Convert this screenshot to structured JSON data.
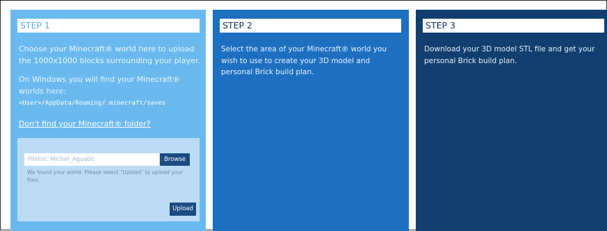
{
  "steps": [
    {
      "title": "STEP 1",
      "paragraph1": "Choose your Minecraft® world here to upload the 1000x1000 blocks surrounding your player.",
      "paragraph2": "On Windows you will find your Minecraft® worlds here:",
      "path": "<User>/AppData/Roaming/.minecraft/saves",
      "link": "Don't find your Minecraft® folder?",
      "upload_box": {
        "file_placeholder": "Filelist: Michel_Aquatic",
        "browse_label": "Browse",
        "found_message": "We found your world. Please select \"Upload\" to upload your files.",
        "upload_label": "Upload"
      }
    },
    {
      "title": "STEP 2",
      "paragraph1": "Select the area of your Minecraft® world you wish to use to create your 3D model and personal Brick build plan."
    },
    {
      "title": "STEP 3",
      "paragraph1": "Download your 3D model STL file and get your personal Brick build plan."
    }
  ],
  "colors": {
    "step1_bg": "#6ab9ee",
    "step2_bg": "#1e6fc0",
    "step3_bg": "#123f70",
    "upload_box_bg": "#bcdcf6",
    "button_bg": "#1b4b82"
  }
}
